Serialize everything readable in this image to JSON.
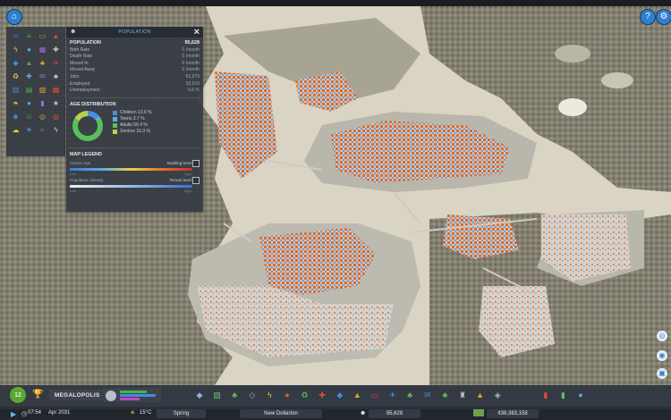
{
  "colors": {
    "accent": "#2f7fd0",
    "title_blue": "#6ab6f5",
    "panel_bg": "#363c44",
    "water": "#d9d4c3",
    "forest": "#7d7a6c",
    "building_orange": "#e4722c",
    "building_blue": "#5b8fd6",
    "children": "#4a8fdb",
    "teens": "#5ab5d2",
    "adults": "#5ac05a",
    "seniors": "#b8d24a"
  },
  "top": {
    "left_icon": "city-icon",
    "help_icon": "question-icon",
    "settings_icon": "gear-icon"
  },
  "population_panel": {
    "title": "POPULATION",
    "header_icon": "people-icon",
    "close_icon": "close-icon",
    "rows": [
      {
        "label": "POPULATION",
        "value": "95,628",
        "main": true
      },
      {
        "label": "Birth Rate",
        "value": "0 /month"
      },
      {
        "label": "Death Rate",
        "value": "0 /month"
      },
      {
        "label": "Moved In",
        "value": "0 /month"
      },
      {
        "label": "Moved Away",
        "value": "0 /month"
      },
      {
        "label": "Jobs",
        "value": "61,979"
      },
      {
        "label": "Employed",
        "value": "53,510"
      },
      {
        "label": "Unemployment",
        "value": "5.6 %"
      }
    ],
    "age_title": "AGE DISTRIBUTION",
    "age_groups": [
      {
        "label": "Children 13.6 %",
        "percent": 13.6,
        "color": "#4a8fdb"
      },
      {
        "label": "Teens 3.7 %",
        "percent": 3.7,
        "color": "#5ab5d2"
      },
      {
        "label": "Adults 66.4 %",
        "percent": 66.4,
        "color": "#5ac05a"
      },
      {
        "label": "Seniors 16.3 %",
        "percent": 16.3,
        "color": "#b8d24a"
      }
    ],
    "map_legend_title": "MAP LEGEND",
    "map_legend": [
      {
        "label": "Citizen Age",
        "value": "Building level",
        "min": "Low",
        "max": "High"
      },
      {
        "label": "Population density",
        "value": "Terrain level",
        "min": "Low",
        "max": "High"
      }
    ]
  },
  "tool_panel": {
    "icons": [
      "road-icon",
      "rail-icon",
      "bus-icon",
      "fire-icon",
      "power-icon",
      "water-icon",
      "building-icon",
      "wrench-icon",
      "shield-icon",
      "school-icon",
      "park-icon",
      "plane-icon",
      "recycle-icon",
      "medical-icon",
      "mail-icon",
      "tree-icon",
      "factory-icon",
      "bank-icon",
      "zone-icon",
      "office-icon",
      "leaf-icon",
      "drop-icon",
      "book-icon",
      "star-icon",
      "people-icon",
      "smile-icon",
      "coin-icon",
      "globe-icon",
      "cloud-icon",
      "sun-icon",
      "wind-icon",
      "bolt-icon"
    ]
  },
  "bottom_bar": {
    "milestone_badge": "12",
    "city_name": "MEGALOPOLIS",
    "time": "07:54",
    "date": "Apr 2031",
    "temperature": "15°C",
    "season": "Spring",
    "city_label": "New Dollarton",
    "population": "95,628",
    "money": "¢38,383,158",
    "toolbar_icons": [
      "road-icon",
      "zone-icon",
      "park-icon",
      "pipe-icon",
      "power-icon",
      "water-icon",
      "recycle-icon",
      "health-icon",
      "police-icon",
      "education-icon",
      "transport-icon",
      "plane-icon",
      "tree-icon",
      "mail-icon",
      "parks-icon",
      "landmark-icon",
      "terraform-icon",
      "area-icon",
      "chart-icon",
      "graph-icon",
      "info-icon"
    ]
  },
  "side_buttons": [
    "map-icon",
    "camera-icon",
    "photo-icon"
  ]
}
